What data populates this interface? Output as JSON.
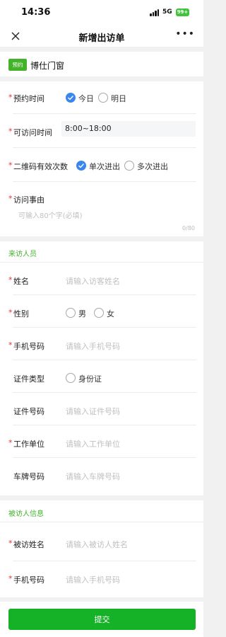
{
  "status_bar": {
    "time": "14:36",
    "network": "5G",
    "battery": "99+"
  },
  "nav": {
    "title": "新增出访单",
    "more": "•••"
  },
  "appointment": {
    "tag": "预约",
    "name": "博仕门窗"
  },
  "visit_time": {
    "label": "预约时间",
    "required": "*",
    "options": [
      {
        "text": "今日",
        "selected": true
      },
      {
        "text": "明日",
        "selected": false
      }
    ]
  },
  "available_time": {
    "label": "可访问时间",
    "required": "*",
    "value": "8:00~18:00"
  },
  "qr_validity": {
    "label": "二维码有效次数",
    "required": "*",
    "options": [
      {
        "text": "单次进出",
        "selected": true
      },
      {
        "text": "多次进出",
        "selected": false
      }
    ]
  },
  "visit_reason": {
    "label": "访问事由",
    "required": "*",
    "placeholder": "可输入80个字(必填)",
    "counter": "0/80"
  },
  "visitor": {
    "section_title": "来访人员",
    "name": {
      "label": "姓名",
      "required": "*",
      "placeholder": "请输入访客姓名"
    },
    "gender": {
      "label": "性别",
      "required": "*",
      "options": [
        {
          "text": "男",
          "selected": false
        },
        {
          "text": "女",
          "selected": false
        }
      ]
    },
    "phone": {
      "label": "手机号码",
      "required": "*",
      "placeholder": "请输入手机号码"
    },
    "id_type": {
      "label": "证件类型",
      "options": [
        {
          "text": "身份证",
          "selected": false
        }
      ]
    },
    "id_number": {
      "label": "证件号码",
      "placeholder": "请输入证件号码"
    },
    "company": {
      "label": "工作单位",
      "required": "*",
      "placeholder": "请输入工作单位"
    },
    "plate": {
      "label": "车牌号码",
      "placeholder": "请输入车牌号码"
    }
  },
  "host": {
    "section_title": "被访人信息",
    "name": {
      "label": "被访姓名",
      "required": "*",
      "placeholder": "请输入被访人姓名"
    },
    "phone": {
      "label": "手机号码",
      "required": "*",
      "placeholder": "请输入手机号码"
    }
  },
  "submit_label": "提交",
  "colors": {
    "accent_green": "#43b32b",
    "button_green": "#15b126",
    "radio_blue": "#3a86f0",
    "required_red": "#e5332d"
  }
}
